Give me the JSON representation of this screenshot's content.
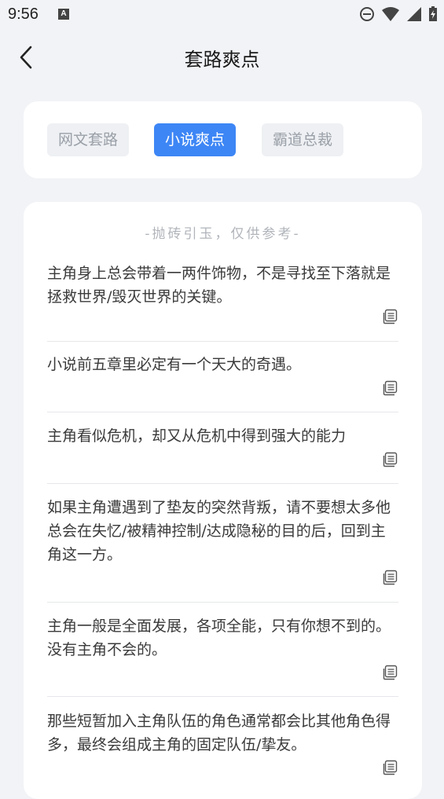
{
  "status_bar": {
    "time": "9:56",
    "notification_icon": "A"
  },
  "header": {
    "title": "套路爽点",
    "back_icon": "chevron-left-icon"
  },
  "tabs": [
    {
      "label": "网文套路",
      "active": false
    },
    {
      "label": "小说爽点",
      "active": true
    },
    {
      "label": "霸道总裁",
      "active": false
    }
  ],
  "list": {
    "note": "-抛砖引玉，仅供参考-",
    "items": [
      {
        "text": "主角身上总会带着一两件饰物，不是寻找至下落就是拯救世界/毁灭世界的关键。"
      },
      {
        "text": "小说前五章里必定有一个天大的奇遇。"
      },
      {
        "text": "主角看似危机，却又从危机中得到强大的能力"
      },
      {
        "text": "如果主角遭遇到了垫友的突然背叛，请不要想太多他总会在失忆/被精神控制/达成隐秘的目的后，回到主角这一方。"
      },
      {
        "text": "主角一般是全面发展，各项全能，只有你想不到的。没有主角不会的。"
      },
      {
        "text": "那些短暂加入主角队伍的角色通常都会比其他角色得多，最终会组成主角的固定队伍/挚友。"
      }
    ]
  },
  "colors": {
    "accent": "#3d86f5",
    "background": "#f2f3f6",
    "card": "#ffffff"
  }
}
